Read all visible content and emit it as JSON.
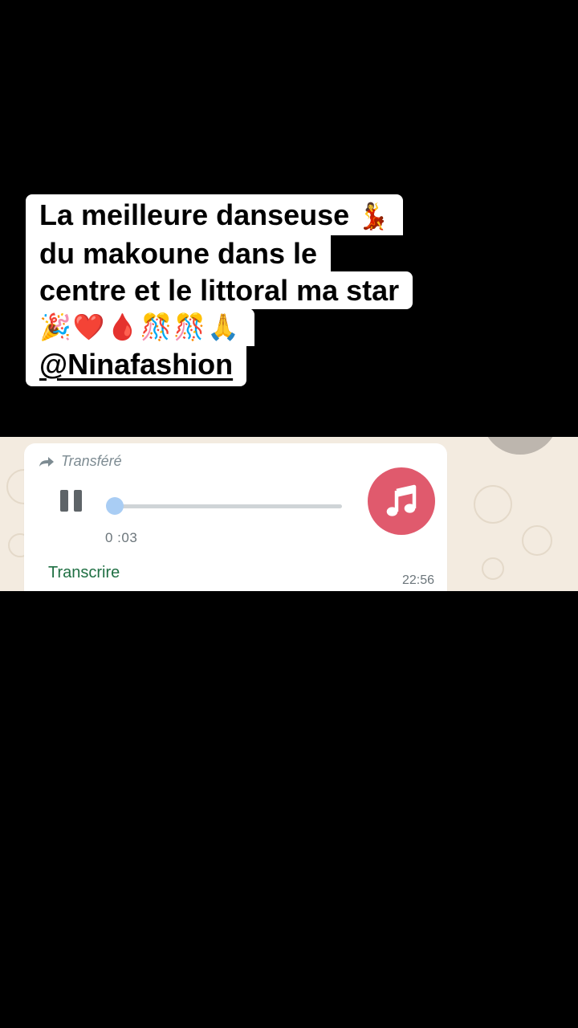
{
  "caption": {
    "line1_text": "La meilleure danseuse",
    "line1_emoji": "💃",
    "line2": "du makoune dans le",
    "line3": "centre et le littoral ma star",
    "emojis": "🎉❤️🩸🎊🎊🙏",
    "mention": "@Ninafashion"
  },
  "message": {
    "forwarded_label": "Transféré",
    "duration": "0 :03",
    "progress": 0.03,
    "transcribe_label": "Transcrire",
    "time": "22:56",
    "forward_icon": "forward-arrow-icon",
    "pause_icon": "pause-icon",
    "avatar_icon": "music-note-icon"
  },
  "colors": {
    "chat_background": "#f3ebe0",
    "bubble": "#ffffff",
    "avatar": "#e05a6d",
    "transcribe": "#1f6f43",
    "progress_knob": "#a9cdf4"
  }
}
